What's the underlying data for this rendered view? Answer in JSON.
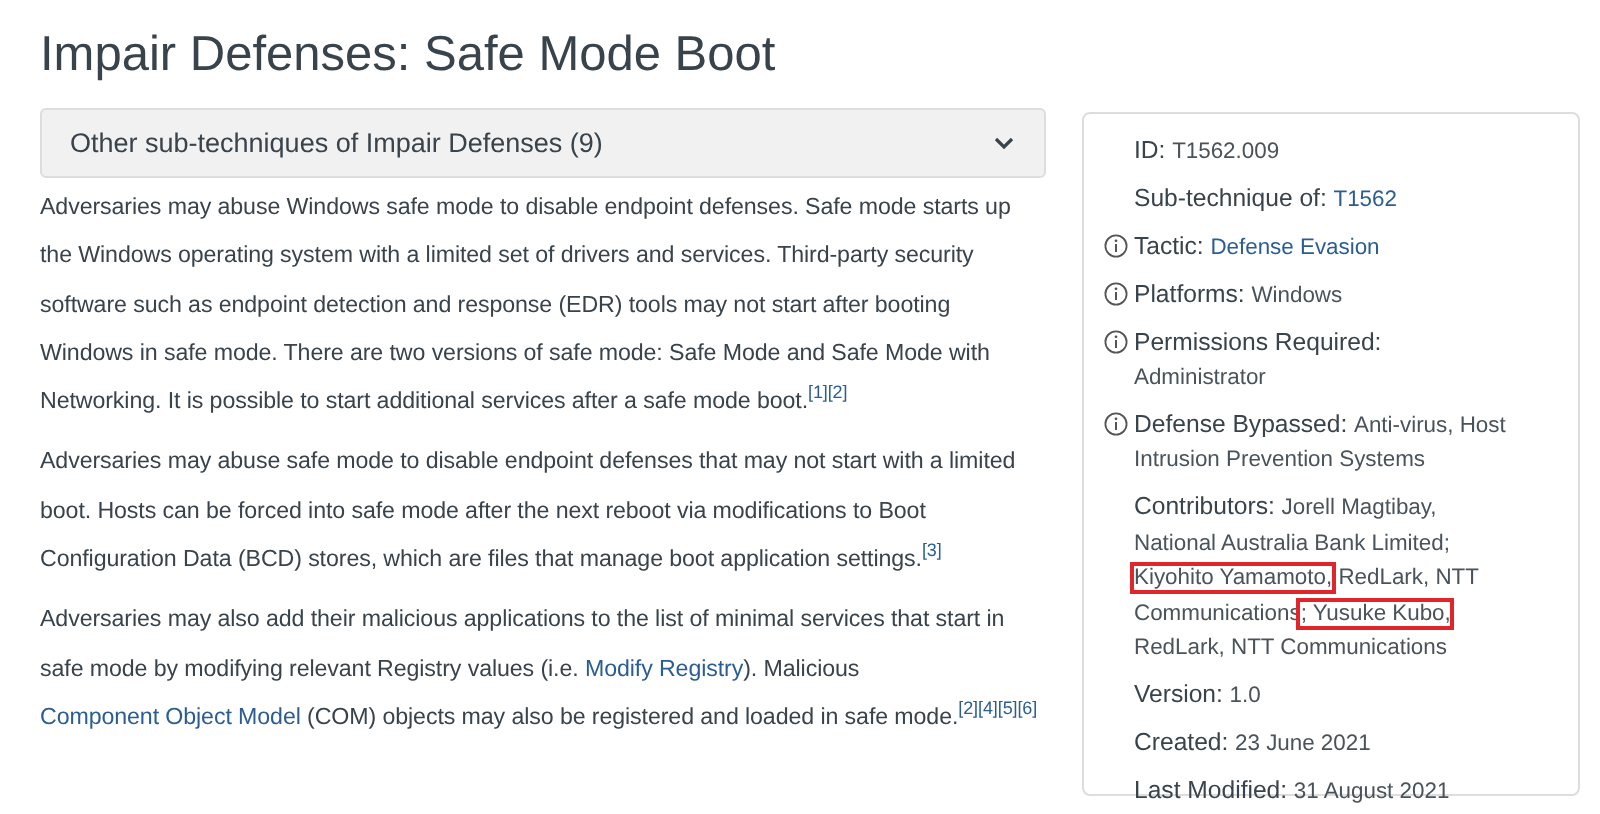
{
  "page_title": "Impair Defenses: Safe Mode Boot",
  "subtechniques_dropdown": {
    "label": "Other sub-techniques of Impair Defenses (9)",
    "expanded": false
  },
  "description": [
    [
      {
        "kind": "text",
        "text": "Adversaries may abuse Windows safe mode to disable endpoint defenses. Safe mode starts up the Windows operating system with a limited set of drivers and services. Third-party security software such as endpoint detection and response (EDR) tools may not start after booting Windows in safe mode. There are two versions of safe mode: Safe Mode and Safe Mode with Networking. It is possible to start additional services after a safe mode boot."
      },
      {
        "kind": "cite",
        "text": "[1]"
      },
      {
        "kind": "cite",
        "text": "[2]"
      }
    ],
    [
      {
        "kind": "text",
        "text": "Adversaries may abuse safe mode to disable endpoint defenses that may not start with a limited boot. Hosts can be forced into safe mode after the next reboot via modifications to Boot Configuration Data (BCD) stores, which are files that manage boot application settings."
      },
      {
        "kind": "cite",
        "text": "[3]"
      }
    ],
    [
      {
        "kind": "text",
        "text": "Adversaries may also add their malicious applications to the list of minimal services that start in safe mode by modifying relevant Registry values (i.e. "
      },
      {
        "kind": "link",
        "text": "Modify Registry"
      },
      {
        "kind": "text",
        "text": "). Malicious "
      },
      {
        "kind": "link",
        "text": "Component Object Model"
      },
      {
        "kind": "text",
        "text": " (COM) objects may also be registered and loaded in safe mode."
      },
      {
        "kind": "cite",
        "text": "[2]"
      },
      {
        "kind": "cite",
        "text": "[4]"
      },
      {
        "kind": "cite",
        "text": "[5]"
      },
      {
        "kind": "cite",
        "text": "[6]"
      }
    ]
  ],
  "info_card": [
    {
      "label": "ID:",
      "info": false,
      "value": [
        {
          "kind": "text",
          "text": "T1562.009"
        }
      ]
    },
    {
      "label": "Sub-technique of:",
      "info": false,
      "value": [
        {
          "kind": "link",
          "text": "T1562"
        }
      ]
    },
    {
      "label": "Tactic:",
      "info": true,
      "value": [
        {
          "kind": "link",
          "text": "Defense Evasion"
        }
      ]
    },
    {
      "label": "Platforms:",
      "info": true,
      "value": [
        {
          "kind": "text",
          "text": "Windows"
        }
      ]
    },
    {
      "label": "Permissions Required:",
      "info": true,
      "value": [
        {
          "kind": "text",
          "text": "Administrator"
        }
      ]
    },
    {
      "label": "Defense Bypassed:",
      "info": true,
      "value": [
        {
          "kind": "text",
          "text": "Anti-virus, Host Intrusion Prevention Systems"
        }
      ]
    },
    {
      "label": "Contributors:",
      "info": false,
      "value": [
        {
          "kind": "text",
          "text": "Jorell Magtibay, National Australia Bank Limited; ",
          "highlighted": false
        },
        {
          "kind": "text",
          "text": "Kiyohito Yamamoto,",
          "highlighted": true
        },
        {
          "kind": "text",
          "text": " RedLark, NTT Communications",
          "highlighted": false
        },
        {
          "kind": "text",
          "text": "; Yusuke Kubo,",
          "highlighted": true
        },
        {
          "kind": "text",
          "text": " RedLark, NTT Communications",
          "highlighted": false
        }
      ]
    },
    {
      "label": "Version:",
      "info": false,
      "value": [
        {
          "kind": "text",
          "text": "1.0"
        }
      ]
    },
    {
      "label": "Created:",
      "info": false,
      "value": [
        {
          "kind": "text",
          "text": "23 June 2021"
        }
      ]
    },
    {
      "label": "Last Modified:",
      "info": false,
      "value": [
        {
          "kind": "text",
          "text": "31 August 2021"
        }
      ]
    }
  ]
}
